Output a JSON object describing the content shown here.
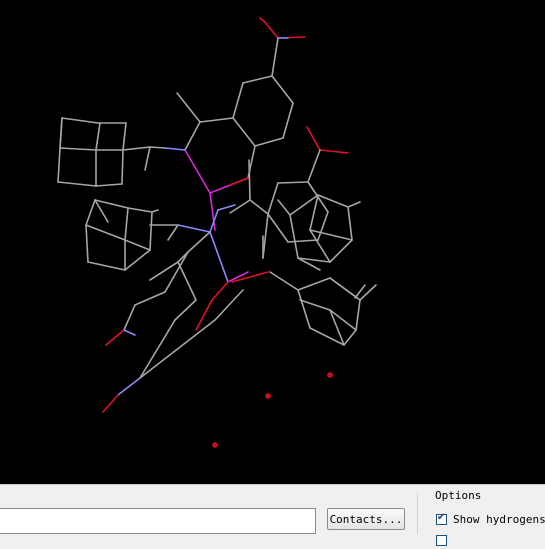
{
  "viewer": {
    "background": "#000000",
    "colors": {
      "carbon": "#a6a6a6",
      "nitrogen": "#8a8aff",
      "oxygen": "#e0102a",
      "highlight": "#d62ad6",
      "water": "#d01020"
    }
  },
  "bottom_panel": {
    "contacts_button_label": "Contacts...",
    "options": {
      "group_label": "Options",
      "show_hydrogens_label": "Show hydrogens",
      "show_hydrogens_checked": true,
      "second_option_label": ""
    }
  }
}
